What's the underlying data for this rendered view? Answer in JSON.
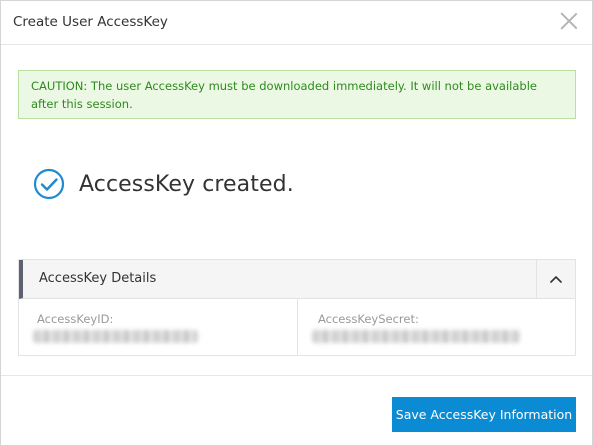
{
  "dialog": {
    "title": "Create User AccessKey"
  },
  "caution": {
    "text": "CAUTION: The user AccessKey must be downloaded immediately. It will not be available after this session."
  },
  "status": {
    "message": "AccessKey created.",
    "icon": "check-circle-icon",
    "icon_color": "#1e8bd0"
  },
  "details": {
    "title": "AccessKey Details",
    "toggle_icon": "chevron-up-icon",
    "fields": [
      {
        "label": "AccessKeyID:",
        "value": ""
      },
      {
        "label": "AccessKeySecret:",
        "value": ""
      }
    ]
  },
  "footer": {
    "save_label": "Save AccessKey Information",
    "button_color": "#0a8bd3"
  }
}
